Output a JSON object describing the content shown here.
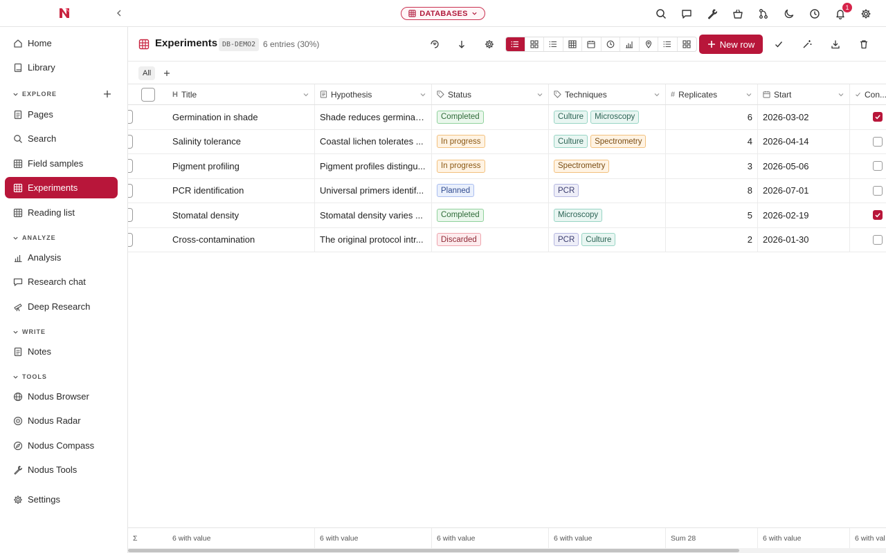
{
  "topbar": {
    "db_pill_label": "DATABASES",
    "notifications_count": "1",
    "icons": [
      "search-icon",
      "chat-icon",
      "wrench-icon",
      "basket-icon",
      "branch-icon",
      "moon-icon",
      "clock-icon",
      "bell-icon",
      "gear-icon"
    ],
    "brand_color": "#b8163a"
  },
  "sidebar": {
    "top_items": [
      {
        "label": "Home",
        "icon": "home-icon"
      },
      {
        "label": "Library",
        "icon": "book-icon"
      }
    ],
    "sections": {
      "explore": "EXPLORE",
      "analyze": "ANALYZE",
      "write": "WRITE",
      "tools": "TOOLS"
    },
    "explore_items": [
      {
        "label": "Pages",
        "icon": "page-icon"
      },
      {
        "label": "Search",
        "icon": "search-icon"
      },
      {
        "label": "Field samples",
        "icon": "grid-icon"
      },
      {
        "label": "Experiments",
        "icon": "grid-icon",
        "active": true
      },
      {
        "label": "Reading list",
        "icon": "grid-icon"
      }
    ],
    "analyze_items": [
      {
        "label": "Analysis",
        "icon": "bar-chart-icon"
      },
      {
        "label": "Research chat",
        "icon": "chat-icon"
      },
      {
        "label": "Deep Research",
        "icon": "telescope-icon"
      }
    ],
    "write_items": [
      {
        "label": "Notes",
        "icon": "note-icon"
      }
    ],
    "tools_items": [
      {
        "label": "Nodus Browser",
        "icon": "globe-icon"
      },
      {
        "label": "Nodus Radar",
        "icon": "radar-icon"
      },
      {
        "label": "Nodus Compass",
        "icon": "compass-icon"
      },
      {
        "label": "Nodus Tools",
        "icon": "wrench-icon"
      }
    ],
    "settings_label": "Settings"
  },
  "toolbar": {
    "title": "Experiments",
    "code": "DB-DEMO2",
    "count": "6 entries (30%)",
    "new_row_label": "New row"
  },
  "tabs": {
    "all_label": "All"
  },
  "table": {
    "columns": {
      "title": "Title",
      "hypothesis": "Hypothesis",
      "status": "Status",
      "techniques": "Techniques",
      "replicates": "Replicates",
      "start": "Start",
      "con": "Con..."
    },
    "rows": [
      {
        "title": "Germination in shade",
        "hypothesis": "Shade reduces germinati...",
        "status": "Completed",
        "status_class": "completed",
        "techniques": [
          "Culture",
          "Microscopy"
        ],
        "replicates": "6",
        "start": "2026-03-02",
        "con": true
      },
      {
        "title": "Salinity tolerance",
        "hypothesis": "Coastal lichen tolerates ...",
        "status": "In progress",
        "status_class": "inprogress",
        "techniques": [
          "Culture",
          "Spectrometry"
        ],
        "replicates": "4",
        "start": "2026-04-14",
        "con": false
      },
      {
        "title": "Pigment profiling",
        "hypothesis": "Pigment profiles distingu...",
        "status": "In progress",
        "status_class": "inprogress",
        "techniques": [
          "Spectrometry"
        ],
        "replicates": "3",
        "start": "2026-05-06",
        "con": false
      },
      {
        "title": "PCR identification",
        "hypothesis": "Universal primers identif...",
        "status": "Planned",
        "status_class": "planned",
        "techniques": [
          "PCR"
        ],
        "replicates": "8",
        "start": "2026-07-01",
        "con": false
      },
      {
        "title": "Stomatal density",
        "hypothesis": "Stomatal density varies ...",
        "status": "Completed",
        "status_class": "completed",
        "techniques": [
          "Microscopy"
        ],
        "replicates": "5",
        "start": "2026-02-19",
        "con": true
      },
      {
        "title": "Cross-contamination",
        "hypothesis": "The original protocol intr...",
        "status": "Discarded",
        "status_class": "discarded",
        "techniques": [
          "PCR",
          "Culture"
        ],
        "replicates": "2",
        "start": "2026-01-30",
        "con": false
      }
    ],
    "footer": {
      "sigma": "Σ",
      "title": "6 with value",
      "hypothesis": "6 with value",
      "status": "6 with value",
      "techniques": "6 with value",
      "replicates": "Sum 28",
      "start": "6 with value",
      "con": "6 with val"
    }
  }
}
